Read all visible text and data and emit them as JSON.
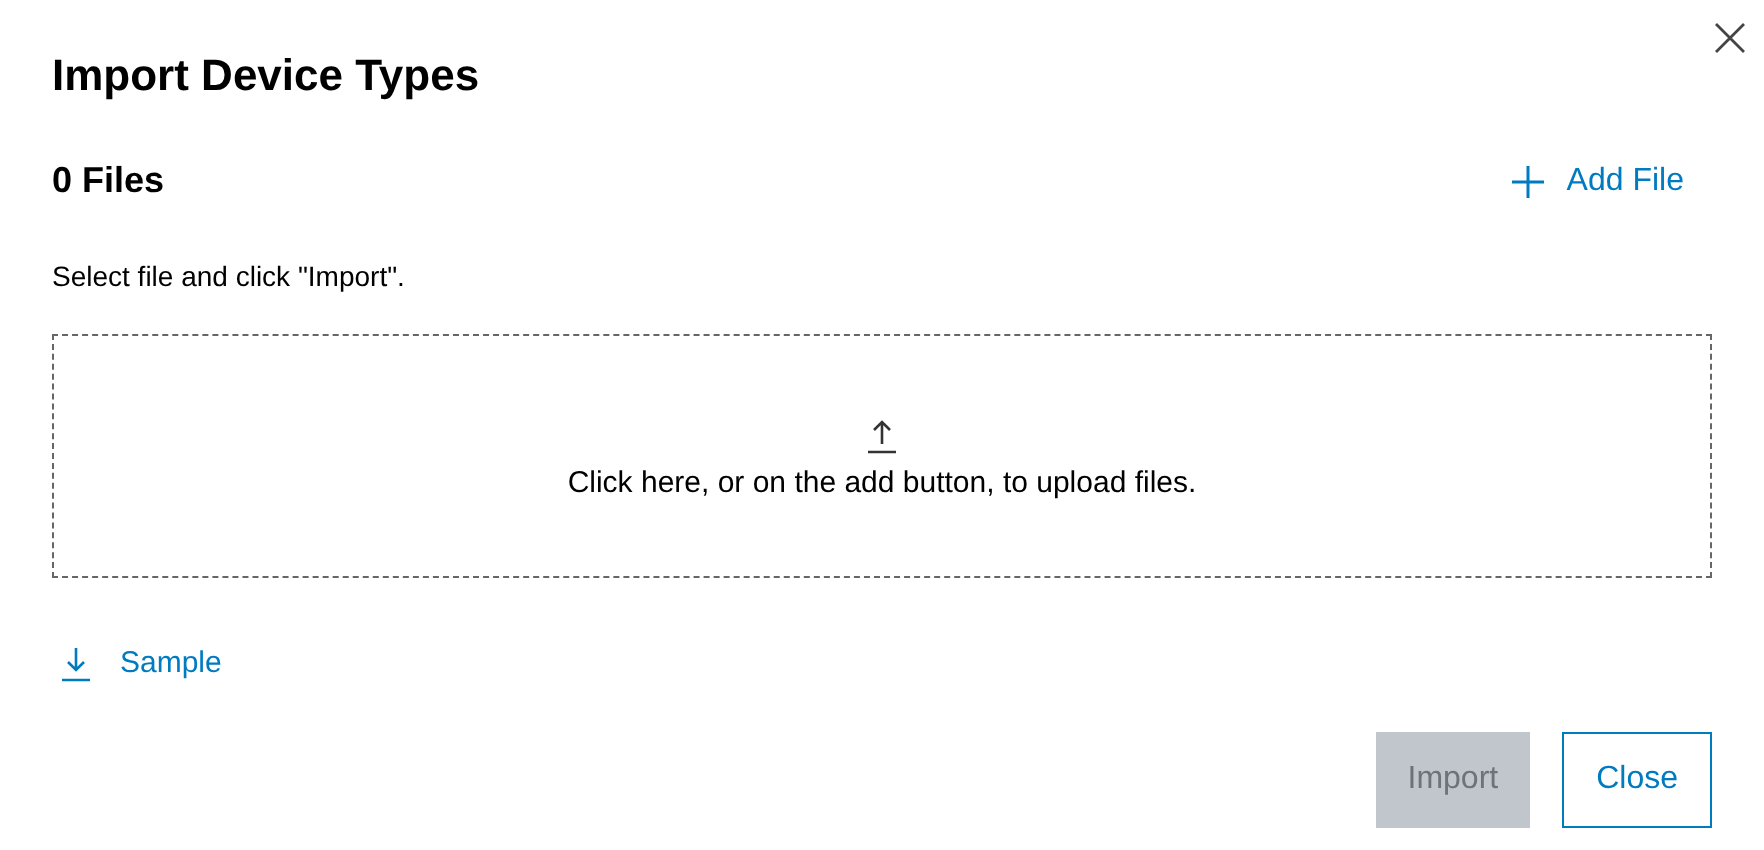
{
  "dialog": {
    "title": "Import Device Types"
  },
  "files": {
    "count_label": "0 Files",
    "add_label": "Add File"
  },
  "instruction": "Select file and click \"Import\".",
  "dropzone": {
    "text": "Click here, or on the add button, to upload files."
  },
  "sample_link": "Sample",
  "buttons": [
    {
      "label": "Import",
      "kind": "primary",
      "disabled": true
    },
    {
      "label": "Close",
      "kind": "secondary",
      "disabled": false
    }
  ]
}
